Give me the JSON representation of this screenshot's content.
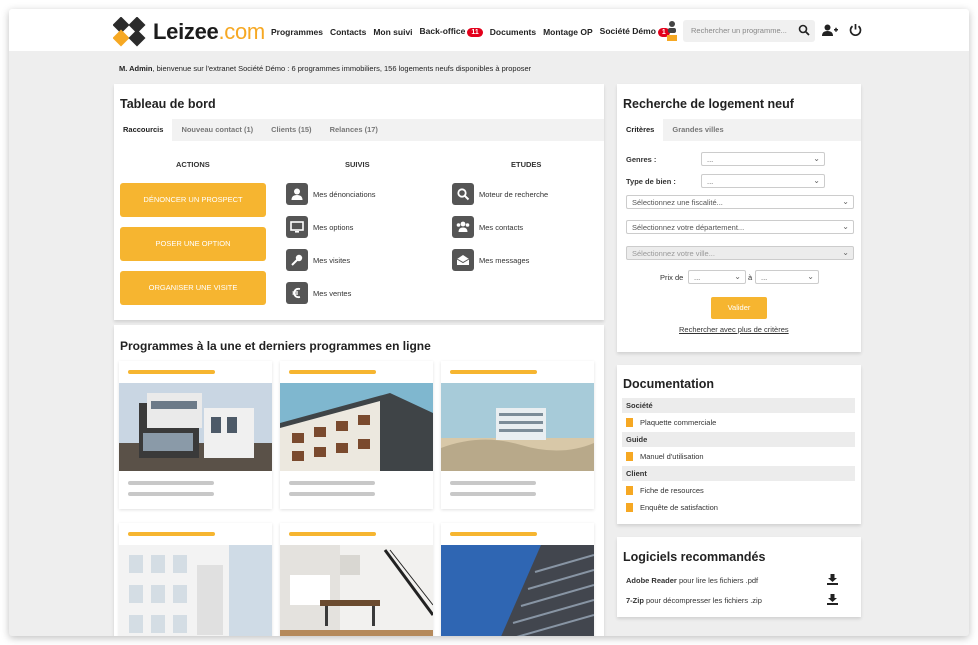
{
  "brand": {
    "name": "Leizee",
    "tld": ".com",
    "accent": "#f6b530",
    "orange": "#f6a823",
    "badge_color": "#e3001b"
  },
  "nav": {
    "items": [
      "Programmes",
      "Contacts",
      "Mon suivi",
      "Back-office",
      "Documents",
      "Montage OP",
      "Société Démo"
    ],
    "backoffice_badge": "11",
    "societe_badge": "1"
  },
  "search": {
    "placeholder": "Rechercher un programme..."
  },
  "icons": {
    "search": "search-icon",
    "add_user": "add-user-icon",
    "power": "power-icon",
    "user": "user-icon"
  },
  "welcome": {
    "user": "M. Admin",
    "message": ", bienvenue sur l'extranet Société Démo : 6 programmes immobiliers, 156 logements neufs disponibles à proposer"
  },
  "dashboard": {
    "title": "Tableau de bord",
    "tabs": [
      "Raccourcis",
      "Nouveau contact (1)",
      "Clients (15)",
      "Relances (17)"
    ],
    "columns": {
      "actions": "ACTIONS",
      "suivis": "SUIVIS",
      "etudes": "ETUDES"
    },
    "actions": [
      "DÉNONCER UN PROSPECT",
      "POSER UNE OPTION",
      "ORGANISER UNE VISITE"
    ],
    "suivis": [
      "Mes dénonciations",
      "Mes options",
      "Mes visites",
      "Mes ventes"
    ],
    "etudes": [
      "Moteur de recherche",
      "Mes contacts",
      "Mes messages"
    ]
  },
  "programmes": {
    "title": "Programmes à la une et derniers programmes en ligne"
  },
  "recherche": {
    "title": "Recherche de logement neuf",
    "tabs": [
      "Critères",
      "Grandes villes"
    ],
    "genres_label": "Genres :",
    "genres_value": "...",
    "type_label": "Type de bien :",
    "type_value": "...",
    "fiscalite": "Sélectionnez une fiscalité...",
    "departement": "Sélectionnez votre département...",
    "ville": "Sélectionnez votre ville...",
    "prix_de": "Prix de",
    "prix_a": "à",
    "prix_min": "...",
    "prix_max": "...",
    "valider": "Valider",
    "plus_criteres": "Rechercher avec plus de critères"
  },
  "documentation": {
    "title": "Documentation",
    "sections": [
      {
        "name": "Société",
        "items": [
          "Plaquette commerciale"
        ]
      },
      {
        "name": "Guide",
        "items": [
          "Manuel d'utilisation"
        ]
      },
      {
        "name": "Client",
        "items": [
          "Fiche de resources",
          "Enquête de satisfaction"
        ]
      }
    ]
  },
  "logiciels": {
    "title": "Logiciels recommandés",
    "items": [
      {
        "name": "Adobe Reader",
        "desc": " pour lire les fichiers .pdf"
      },
      {
        "name": "7-Zip",
        "desc": " pour décompresser les fichiers .zip"
      }
    ]
  }
}
